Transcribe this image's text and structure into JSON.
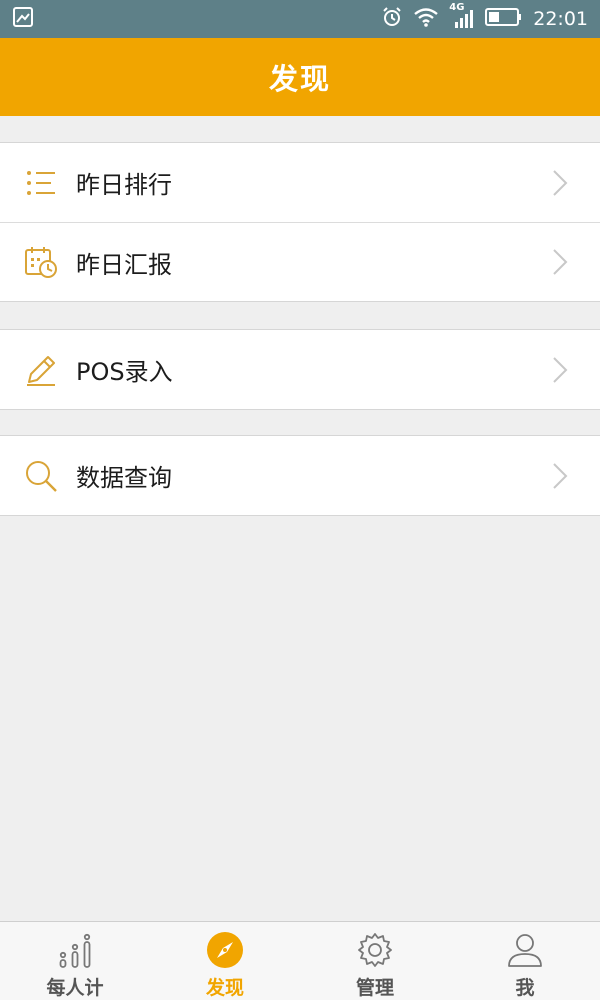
{
  "status_bar": {
    "network": "4G",
    "time": "22:01",
    "icons": [
      "image-icon",
      "alarm-icon",
      "wifi-icon",
      "signal-icon",
      "battery-icon"
    ]
  },
  "header": {
    "title": "发现"
  },
  "menu": {
    "groups": [
      {
        "items": [
          {
            "label": "昨日排行",
            "icon": "list-icon"
          },
          {
            "label": "昨日汇报",
            "icon": "calendar-clock-icon"
          }
        ]
      },
      {
        "items": [
          {
            "label": "POS录入",
            "icon": "pencil-icon"
          }
        ]
      },
      {
        "items": [
          {
            "label": "数据查询",
            "icon": "search-icon"
          }
        ]
      }
    ]
  },
  "tabbar": {
    "tabs": [
      {
        "label": "每人计",
        "icon": "bar-chart-icon"
      },
      {
        "label": "发现",
        "icon": "compass-icon",
        "active": true
      },
      {
        "label": "管理",
        "icon": "gear-icon"
      },
      {
        "label": "我",
        "icon": "person-icon"
      }
    ]
  },
  "colors": {
    "accent": "#f1a500",
    "status_bar": "#5e8088",
    "background": "#efefef",
    "icon_gold": "#d9a437"
  }
}
